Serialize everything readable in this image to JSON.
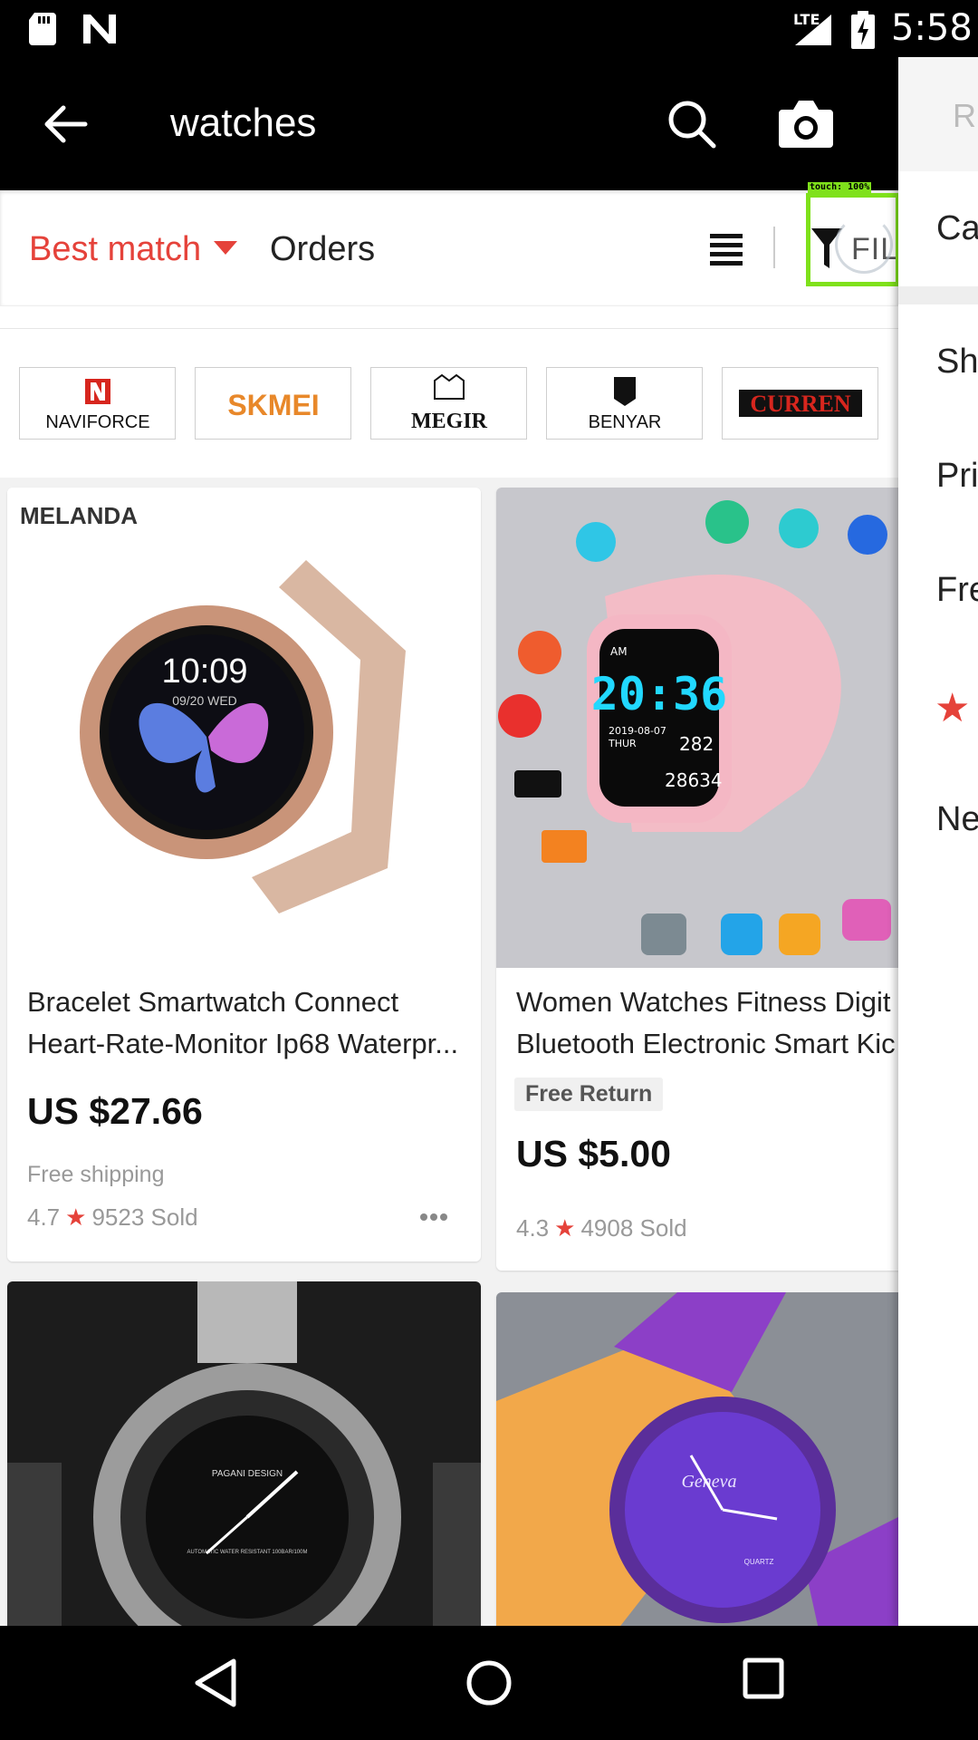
{
  "status_bar": {
    "time": "5:58",
    "network": "LTE",
    "icons": [
      "sd-card-icon",
      "n-notification-icon",
      "signal-icon",
      "battery-charging-icon"
    ]
  },
  "app_bar": {
    "search_query": "watches",
    "icons": [
      "back-arrow-icon",
      "search-icon",
      "camera-icon"
    ]
  },
  "sort_bar": {
    "best_match": "Best match",
    "orders": "Orders",
    "filter_label": "FILT",
    "active_color": "#e5423a"
  },
  "touch_indicator": {
    "label": "touch: 100%",
    "color": "#7fe11b"
  },
  "brands": [
    "NAVIFORCE",
    "SKMEI",
    "MEGIR",
    "BENYAR",
    "CURREN"
  ],
  "products": [
    {
      "brand_logo": "MELANDA",
      "title_line1": "Bracelet Smartwatch Connect",
      "title_line2": "Heart-Rate-Monitor Ip68 Waterpr...",
      "price": "US $27.66",
      "shipping": "Free shipping",
      "rating": "4.7",
      "sold": "9523 Sold"
    },
    {
      "title_line1": "Women Watches Fitness Digit",
      "title_line2": "Bluetooth Electronic Smart Kic",
      "badge": "Free Return",
      "price": "US $5.00",
      "rating": "4.3",
      "sold": "4908 Sold",
      "screen_time": "20:36",
      "screen_date": "2019-08-07",
      "screen_day": "THUR",
      "screen_ampm": "AM",
      "heart_rate": "282",
      "steps": "28634"
    },
    {
      "dial_brand": "PAGANI DESIGN",
      "dial_text": "AUTOMATIC WATER RESISTANT 100BAR/100M"
    },
    {
      "dial_brand": "Geneva",
      "dial_text": "QUARTZ"
    }
  ],
  "watch_screen": {
    "time": "10:09",
    "date": "09/20 WED"
  },
  "drawer": {
    "reset_label": "RI",
    "items": [
      "Cat",
      "Shi",
      "Pri",
      "Fre",
      "Ne"
    ]
  }
}
